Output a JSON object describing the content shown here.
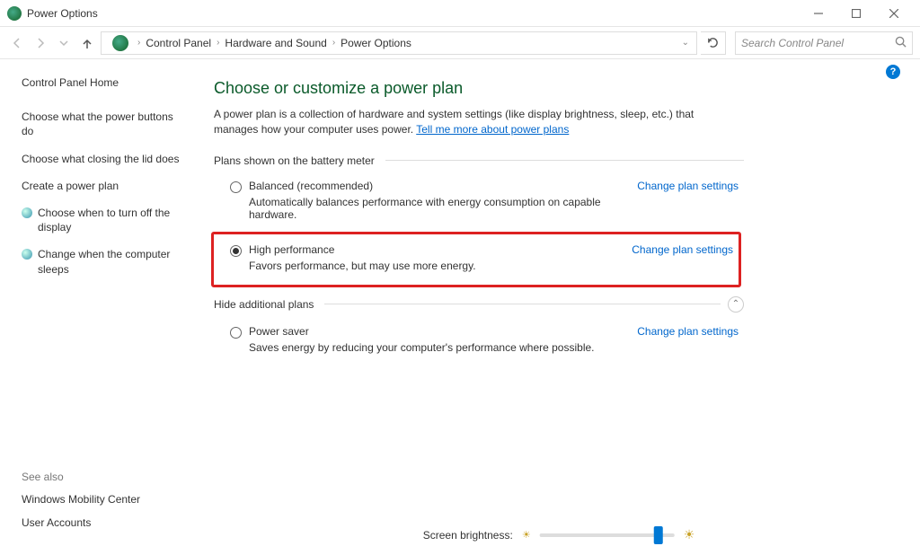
{
  "window": {
    "title": "Power Options"
  },
  "breadcrumb": {
    "items": [
      "Control Panel",
      "Hardware and Sound",
      "Power Options"
    ]
  },
  "search": {
    "placeholder": "Search Control Panel"
  },
  "sidebar": {
    "home": "Control Panel Home",
    "links": [
      {
        "label": "Choose what the power buttons do",
        "icon": false
      },
      {
        "label": "Choose what closing the lid does",
        "icon": false
      },
      {
        "label": "Create a power plan",
        "icon": false
      },
      {
        "label": "Choose when to turn off the display",
        "icon": true
      },
      {
        "label": "Change when the computer sleeps",
        "icon": true
      }
    ]
  },
  "seealso": {
    "heading": "See also",
    "links": [
      "Windows Mobility Center",
      "User Accounts"
    ]
  },
  "main": {
    "title": "Choose or customize a power plan",
    "description": "A power plan is a collection of hardware and system settings (like display brightness, sleep, etc.) that manages how your computer uses power. ",
    "learn_more": "Tell me more about power plans",
    "section1": "Plans shown on the battery meter",
    "section2": "Hide additional plans",
    "change_link": "Change plan settings",
    "plans": [
      {
        "name": "Balanced (recommended)",
        "desc": "Automatically balances performance with energy consumption on capable hardware.",
        "checked": false
      },
      {
        "name": "High performance",
        "desc": "Favors performance, but may use more energy.",
        "checked": true,
        "highlight": true
      },
      {
        "name": "Power saver",
        "desc": "Saves energy by reducing your computer's performance where possible.",
        "checked": false
      }
    ],
    "brightness_label": "Screen brightness:"
  }
}
